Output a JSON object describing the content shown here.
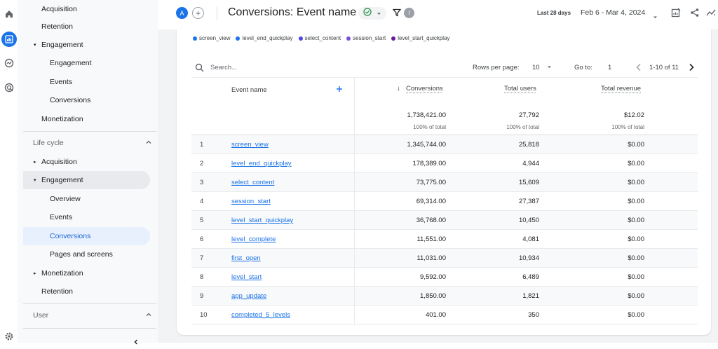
{
  "header": {
    "avatar_letter": "A",
    "add_label": "+",
    "title": "Conversions: Event name",
    "filter_badge": "I",
    "date_range_label": "Last 28 days",
    "date_range": "Feb 6 - Mar 4, 2024"
  },
  "nav": {
    "top": [
      {
        "label": "Acquisition",
        "level": 1
      },
      {
        "label": "Retention",
        "level": 1
      },
      {
        "label": "Engagement",
        "level": 1,
        "caret": "▾"
      },
      {
        "label": "Engagement",
        "level": 2
      },
      {
        "label": "Events",
        "level": 2
      },
      {
        "label": "Conversions",
        "level": 2
      },
      {
        "label": "Monetization",
        "level": 1
      }
    ],
    "lifecycle_label": "Life cycle",
    "lifecycle": [
      {
        "label": "Acquisition",
        "level": 1,
        "caret": "▸"
      },
      {
        "label": "Engagement",
        "level": 1,
        "caret": "▾"
      },
      {
        "label": "Overview",
        "level": 2
      },
      {
        "label": "Events",
        "level": 2
      },
      {
        "label": "Conversions",
        "level": 2
      },
      {
        "label": "Pages and screens",
        "level": 2
      },
      {
        "label": "Monetization",
        "level": 1,
        "caret": "▸"
      },
      {
        "label": "Retention",
        "level": 1
      }
    ],
    "user_label": "User"
  },
  "legend": [
    {
      "label": "screen_view",
      "color": "#1a73e8"
    },
    {
      "label": "level_end_quickplay",
      "color": "#1a73e8"
    },
    {
      "label": "select_content",
      "color": "#4f46e5"
    },
    {
      "label": "session_start",
      "color": "#7b4fd6"
    },
    {
      "label": "level_start_quickplay",
      "color": "#6a1b9a"
    }
  ],
  "toolbar": {
    "search_placeholder": "Search...",
    "rows_per_page_label": "Rows per page:",
    "rows_per_page": "10",
    "goto_label": "Go to:",
    "goto_value": "1",
    "range": "1-10 of 11"
  },
  "table": {
    "col_event": "Event name",
    "col_conversions": "Conversions",
    "col_users": "Total users",
    "col_revenue": "Total revenue",
    "sort_icon": "↓",
    "totals": {
      "conversions": "1,738,421.00",
      "users": "27,792",
      "revenue": "$12.02"
    },
    "pct": {
      "conversions": "100% of total",
      "users": "100% of total",
      "revenue": "100% of total"
    },
    "rows": [
      {
        "n": "1",
        "name": "screen_view",
        "conv": "1,345,744.00",
        "users": "25,818",
        "rev": "$0.00"
      },
      {
        "n": "2",
        "name": "level_end_quickplay",
        "conv": "178,389.00",
        "users": "4,944",
        "rev": "$0.00"
      },
      {
        "n": "3",
        "name": "select_content",
        "conv": "73,775.00",
        "users": "15,609",
        "rev": "$0.00"
      },
      {
        "n": "4",
        "name": "session_start",
        "conv": "69,314.00",
        "users": "27,387",
        "rev": "$0.00"
      },
      {
        "n": "5",
        "name": "level_start_quickplay",
        "conv": "36,768.00",
        "users": "10,450",
        "rev": "$0.00"
      },
      {
        "n": "6",
        "name": "level_complete",
        "conv": "11,551.00",
        "users": "4,081",
        "rev": "$0.00"
      },
      {
        "n": "7",
        "name": "first_open",
        "conv": "11,031.00",
        "users": "10,934",
        "rev": "$0.00"
      },
      {
        "n": "8",
        "name": "level_start",
        "conv": "9,592.00",
        "users": "6,489",
        "rev": "$0.00"
      },
      {
        "n": "9",
        "name": "app_update",
        "conv": "1,850.00",
        "users": "1,821",
        "rev": "$0.00"
      },
      {
        "n": "10",
        "name": "completed_5_levels",
        "conv": "401.00",
        "users": "350",
        "rev": "$0.00"
      }
    ]
  }
}
